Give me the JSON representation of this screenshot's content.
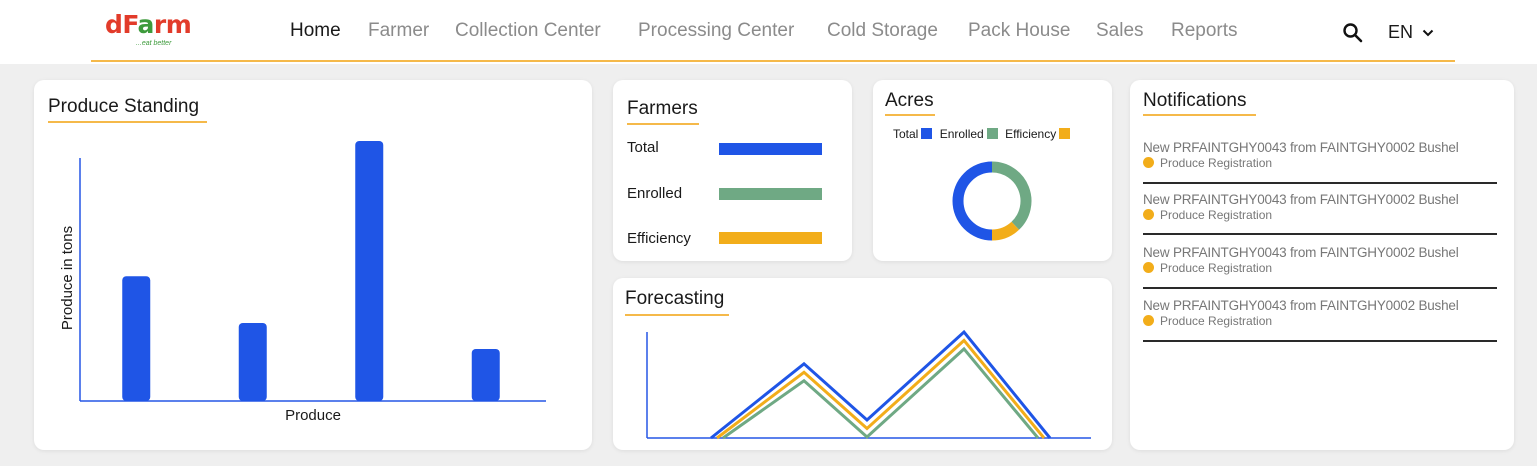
{
  "header": {
    "logo": {
      "main": "dFarm",
      "tagline": "...eat better"
    },
    "nav": [
      {
        "label": "Home",
        "active": true
      },
      {
        "label": "Farmer",
        "active": false
      },
      {
        "label": "Collection Center",
        "active": false
      },
      {
        "label": "Processing Center",
        "active": false
      },
      {
        "label": "Cold Storage",
        "active": false
      },
      {
        "label": "Pack House",
        "active": false
      },
      {
        "label": "Sales",
        "active": false
      },
      {
        "label": "Reports",
        "active": false
      }
    ],
    "search_icon": "search-icon",
    "language": "EN",
    "language_icon": "chevron-down-icon"
  },
  "colors": {
    "accent": "#f5b94a",
    "blue": "#1f55e6",
    "green": "#6fa984",
    "yellow": "#f2ad1a"
  },
  "produce_standing": {
    "title": "Produce Standing",
    "chart_data": {
      "type": "bar",
      "title": "Produce Standing",
      "xlabel": "Produce",
      "ylabel": "Produce in tons",
      "categories": [
        "",
        "",
        "",
        ""
      ],
      "values": [
        48,
        30,
        100,
        20
      ],
      "ylim": [
        0,
        100
      ],
      "color": "#1f55e6",
      "grid": false
    }
  },
  "farmers": {
    "title": "Farmers",
    "rows": [
      {
        "label": "Total",
        "color": "#1f55e6"
      },
      {
        "label": "Enrolled",
        "color": "#6fa984"
      },
      {
        "label": "Efficiency",
        "color": "#f2ad1a"
      }
    ]
  },
  "acres": {
    "title": "Acres",
    "legend": [
      {
        "label": "Total",
        "color": "#1f55e6"
      },
      {
        "label": "Enrolled",
        "color": "#6fa984"
      },
      {
        "label": "Efficiency",
        "color": "#f2ad1a"
      }
    ],
    "chart_data": {
      "type": "pie",
      "donut": true,
      "slices": [
        {
          "label": "Total",
          "value": 50,
          "color": "#1f55e6"
        },
        {
          "label": "Enrolled",
          "value": 38,
          "color": "#6fa984"
        },
        {
          "label": "Efficiency",
          "value": 12,
          "color": "#f2ad1a"
        }
      ]
    }
  },
  "forecasting": {
    "title": "Forecasting",
    "chart_data": {
      "type": "line",
      "x": [
        0,
        1,
        2,
        3,
        4,
        5
      ],
      "ylim": [
        0,
        100
      ],
      "series": [
        {
          "color": "#1f55e6",
          "values": [
            0,
            70,
            17,
            100,
            0
          ]
        },
        {
          "color": "#f2ad1a",
          "values": [
            0,
            62,
            9,
            92,
            0
          ]
        },
        {
          "color": "#6fa984",
          "values": [
            0,
            54,
            1,
            84,
            0
          ]
        }
      ],
      "grid": false
    }
  },
  "notifications": {
    "title": "Notifications",
    "items": [
      {
        "text": "New PRFAINTGHY0043 from FAINTGHY0002 Bushel",
        "sub": "Produce Registration"
      },
      {
        "text": "New PRFAINTGHY0043 from FAINTGHY0002 Bushel",
        "sub": "Produce Registration"
      },
      {
        "text": "New PRFAINTGHY0043 from FAINTGHY0002 Bushel",
        "sub": "Produce Registration"
      },
      {
        "text": "New PRFAINTGHY0043 from FAINTGHY0002 Bushel",
        "sub": "Produce Registration"
      }
    ]
  }
}
